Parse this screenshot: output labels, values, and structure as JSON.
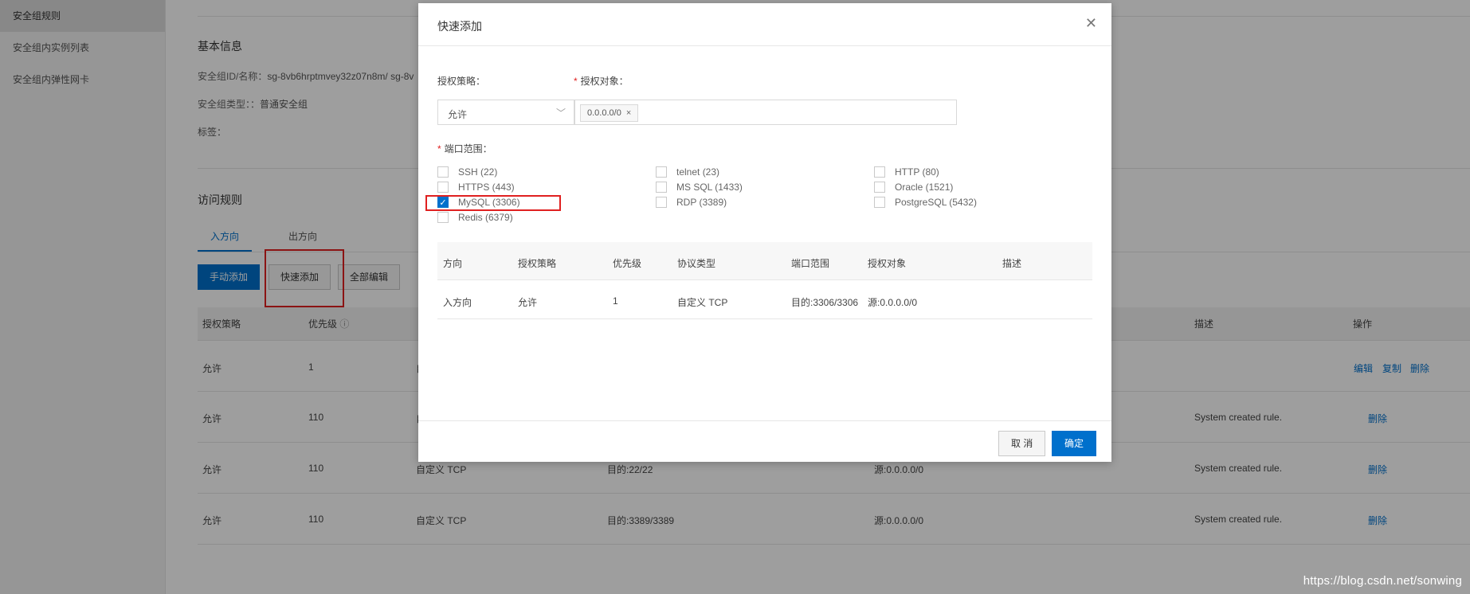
{
  "sidebar": {
    "items": [
      {
        "label": "安全组规则"
      },
      {
        "label": "安全组内实例列表"
      },
      {
        "label": "安全组内弹性网卡"
      }
    ]
  },
  "basic_info": {
    "title": "基本信息",
    "id_label": "安全组ID/名称：",
    "id_value": "sg-8vb6hrptmvey32z07n8m/ sg-8v",
    "type_label": "安全组类型：：",
    "type_value": "普通安全组",
    "tags_label": "标签："
  },
  "access_rules": {
    "title": "访问规则",
    "tabs": [
      {
        "label": "入方向"
      },
      {
        "label": "出方向"
      }
    ],
    "buttons": {
      "manual_add": "手动添加",
      "quick_add": "快速添加",
      "edit_all": "全部编辑"
    },
    "columns": {
      "policy": "授权策略",
      "priority": "优先级",
      "desc": "描述",
      "ops": "操作"
    },
    "rows": [
      {
        "policy": "允许",
        "priority": "1",
        "protocol": "自",
        "port": "",
        "source": "",
        "desc": "",
        "actions": [
          "编辑",
          "复制",
          "删除"
        ]
      },
      {
        "policy": "允许",
        "priority": "110",
        "protocol": "自",
        "port": "",
        "source": "",
        "desc": "System created rule.",
        "actions": [
          "删除"
        ]
      },
      {
        "policy": "允许",
        "priority": "110",
        "protocol": "自定义 TCP",
        "port": "目的:22/22",
        "source": "源:0.0.0.0/0",
        "desc": "System created rule.",
        "actions": [
          "删除"
        ]
      },
      {
        "policy": "允许",
        "priority": "110",
        "protocol": "自定义 TCP",
        "port": "目的:3389/3389",
        "source": "源:0.0.0.0/0",
        "desc": "System created rule.",
        "actions": [
          "删除"
        ]
      }
    ]
  },
  "dialog": {
    "title": "快速添加",
    "close_icon": "close-icon",
    "policy_label": "授权策略：",
    "policy_value": "允许",
    "target_label": "授权对象：",
    "target_tag": "0.0.0.0/0",
    "port_label": "端口范围：",
    "ports": [
      {
        "label": "SSH (22)",
        "checked": false
      },
      {
        "label": "HTTPS (443)",
        "checked": false
      },
      {
        "label": "MySQL (3306)",
        "checked": true
      },
      {
        "label": "Redis (6379)",
        "checked": false
      },
      {
        "label": "telnet (23)",
        "checked": false
      },
      {
        "label": "MS SQL (1433)",
        "checked": false
      },
      {
        "label": "RDP (3389)",
        "checked": false
      },
      {
        "label": "HTTP (80)",
        "checked": false
      },
      {
        "label": "Oracle (1521)",
        "checked": false
      },
      {
        "label": "PostgreSQL (5432)",
        "checked": false
      }
    ],
    "table": {
      "headers": [
        "方向",
        "授权策略",
        "优先级",
        "协议类型",
        "端口范围",
        "授权对象",
        "描述"
      ],
      "row": [
        "入方向",
        "允许",
        "1",
        "自定义 TCP",
        "目的:3306/3306",
        "源:0.0.0.0/0",
        ""
      ]
    },
    "cancel": "取 消",
    "confirm": "确定"
  },
  "watermark": "https://blog.csdn.net/sonwing",
  "colors": {
    "accent": "#0070cc",
    "highlight": "#e02020"
  }
}
